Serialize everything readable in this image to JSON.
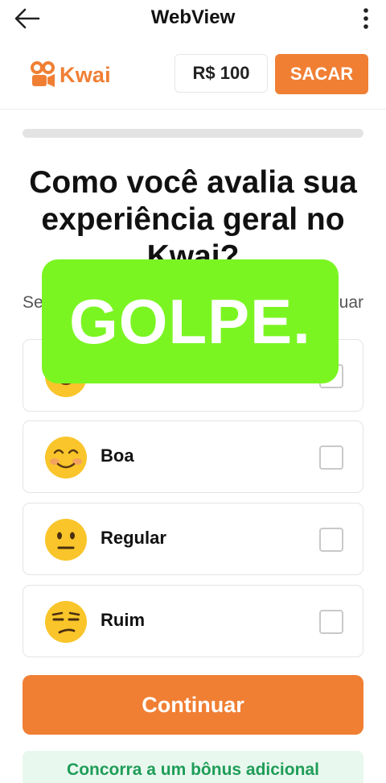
{
  "topbar": {
    "title": "WebView",
    "back_icon": "arrow-left-icon",
    "more_icon": "more-vertical-icon"
  },
  "appbar": {
    "logo_text": "Kwai",
    "balance": "R$ 100",
    "withdraw_label": "SACAR"
  },
  "colors": {
    "accent": "#f07f34",
    "overlay": "#7bf522",
    "bonus_text": "#1e9d58",
    "bonus_bg": "#e9f8ee"
  },
  "progress": {
    "fraction": 0.0
  },
  "question": "Como você avalia sua experiência geral no Kwai?",
  "subtitle": {
    "left": "Se",
    "right": "uar"
  },
  "options": [
    {
      "label": "",
      "emoji": "smiling-face-icon"
    },
    {
      "label": "Boa",
      "emoji": "blushing-face-icon"
    },
    {
      "label": "Regular",
      "emoji": "neutral-face-icon"
    },
    {
      "label": "Ruim",
      "emoji": "unamused-face-icon"
    }
  ],
  "continue_label": "Continuar",
  "bonus_text": "Concorra a um bônus adicional",
  "overlay_text": "GOLPE."
}
